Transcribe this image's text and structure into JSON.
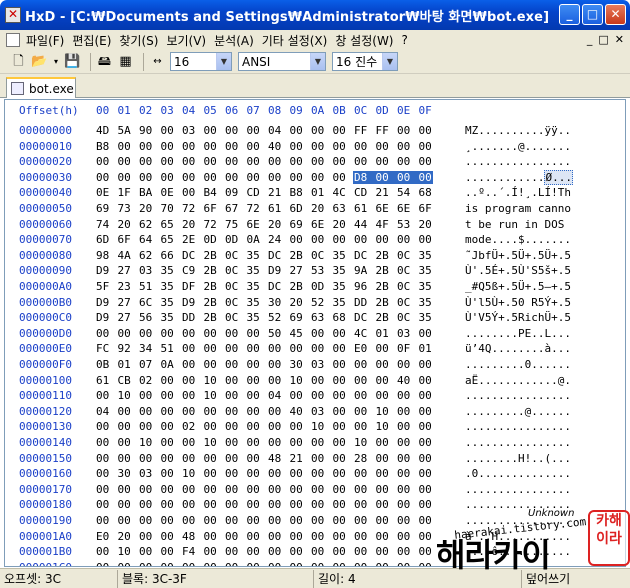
{
  "window": {
    "title": "HxD - [C:₩Documents and Settings₩Administrator₩바탕 화면₩bot.exe]",
    "buttons": [
      "_",
      "□",
      "✕"
    ]
  },
  "menu": {
    "items": [
      "파일(F)",
      "편집(E)",
      "찾기(S)",
      "보기(V)",
      "분석(A)",
      "기타 설정(X)",
      "창 설정(W)",
      "?"
    ],
    "mdi_buttons": [
      "_",
      "□",
      "✕"
    ]
  },
  "toolbar": {
    "bytes_per_row": "16",
    "charset": "ANSI",
    "base": "16 진수"
  },
  "tab": {
    "label": "bot.exe"
  },
  "hex": {
    "header_label": "Offset(h)",
    "columns": [
      "00",
      "01",
      "02",
      "03",
      "04",
      "05",
      "06",
      "07",
      "08",
      "09",
      "0A",
      "0B",
      "0C",
      "0D",
      "0E",
      "0F"
    ],
    "selection": {
      "row": 3,
      "from": 12,
      "to": 15
    },
    "rows": [
      {
        "offset": "00000000",
        "bytes": "4D 5A 90 00 03 00 00 00 04 00 00 00 FF FF 00 00",
        "ascii": "MZ..........ÿÿ.."
      },
      {
        "offset": "00000010",
        "bytes": "B8 00 00 00 00 00 00 00 40 00 00 00 00 00 00 00",
        "ascii": "¸.......@......."
      },
      {
        "offset": "00000020",
        "bytes": "00 00 00 00 00 00 00 00 00 00 00 00 00 00 00 00",
        "ascii": "................"
      },
      {
        "offset": "00000030",
        "bytes": "00 00 00 00 00 00 00 00 00 00 00 00 D8 00 00 00",
        "ascii": "............Ø..."
      },
      {
        "offset": "00000040",
        "bytes": "0E 1F BA 0E 00 B4 09 CD 21 B8 01 4C CD 21 54 68",
        "ascii": "..º..´.Í!¸.LÍ!Th"
      },
      {
        "offset": "00000050",
        "bytes": "69 73 20 70 72 6F 67 72 61 6D 20 63 61 6E 6E 6F",
        "ascii": "is program canno"
      },
      {
        "offset": "00000060",
        "bytes": "74 20 62 65 20 72 75 6E 20 69 6E 20 44 4F 53 20",
        "ascii": "t be run in DOS "
      },
      {
        "offset": "00000070",
        "bytes": "6D 6F 64 65 2E 0D 0D 0A 24 00 00 00 00 00 00 00",
        "ascii": "mode....$......."
      },
      {
        "offset": "00000080",
        "bytes": "98 4A 62 66 DC 2B 0C 35 DC 2B 0C 35 DC 2B 0C 35",
        "ascii": "˜JbfÜ+.5Ü+.5Ü+.5"
      },
      {
        "offset": "00000090",
        "bytes": "D9 27 03 35 C9 2B 0C 35 D9 27 53 35 9A 2B 0C 35",
        "ascii": "Ù'.5É+.5Ù'S5š+.5"
      },
      {
        "offset": "000000A0",
        "bytes": "5F 23 51 35 DF 2B 0C 35 DC 2B 0D 35 96 2B 0C 35",
        "ascii": "_#Q5ß+.5Ü+.5–+.5"
      },
      {
        "offset": "000000B0",
        "bytes": "D9 27 6C 35 D9 2B 0C 35 30 20 52 35 DD 2B 0C 35",
        "ascii": "Ù'l5Ù+.50 R5Ý+.5"
      },
      {
        "offset": "000000C0",
        "bytes": "D9 27 56 35 DD 2B 0C 35 52 69 63 68 DC 2B 0C 35",
        "ascii": "Ù'V5Ý+.5RichÜ+.5"
      },
      {
        "offset": "000000D0",
        "bytes": "00 00 00 00 00 00 00 00 50 45 00 00 4C 01 03 00",
        "ascii": "........PE..L..."
      },
      {
        "offset": "000000E0",
        "bytes": "FC 92 34 51 00 00 00 00 00 00 00 00 E0 00 0F 01",
        "ascii": "ü’4Q........à..."
      },
      {
        "offset": "000000F0",
        "bytes": "0B 01 07 0A 00 00 00 00 00 30 03 00 00 00 00 00",
        "ascii": ".........0......"
      },
      {
        "offset": "00000100",
        "bytes": "61 CB 02 00 00 10 00 00 00 10 00 00 00 00 40 00",
        "ascii": "aË............@."
      },
      {
        "offset": "00000110",
        "bytes": "00 10 00 00 00 10 00 00 04 00 00 00 00 00 00 00",
        "ascii": "................"
      },
      {
        "offset": "00000120",
        "bytes": "04 00 00 00 00 00 00 00 00 40 03 00 00 10 00 00",
        "ascii": ".........@......"
      },
      {
        "offset": "00000130",
        "bytes": "00 00 00 00 02 00 00 00 00 00 10 00 00 10 00 00",
        "ascii": "................"
      },
      {
        "offset": "00000140",
        "bytes": "00 00 10 00 00 10 00 00 00 00 00 00 10 00 00 00",
        "ascii": "................"
      },
      {
        "offset": "00000150",
        "bytes": "00 00 00 00 00 00 00 00 48 21 00 00 28 00 00 00",
        "ascii": "........H!..(..."
      },
      {
        "offset": "00000160",
        "bytes": "00 30 03 00 10 00 00 00 00 00 00 00 00 00 00 00",
        "ascii": ".0.............."
      },
      {
        "offset": "00000170",
        "bytes": "00 00 00 00 00 00 00 00 00 00 00 00 00 00 00 00",
        "ascii": "................"
      },
      {
        "offset": "00000180",
        "bytes": "00 00 00 00 00 00 00 00 00 00 00 00 00 00 00 00",
        "ascii": "................"
      },
      {
        "offset": "00000190",
        "bytes": "00 00 00 00 00 00 00 00 00 00 00 00 00 00 00 00",
        "ascii": "................"
      },
      {
        "offset": "000001A0",
        "bytes": "E0 20 00 00 48 00 00 00 00 00 00 00 00 00 00 00",
        "ascii": "à ..H..........."
      },
      {
        "offset": "000001B0",
        "bytes": "00 10 00 00 F4 00 00 00 00 00 00 00 00 00 00 00",
        "ascii": "....ô..........."
      },
      {
        "offset": "000001C0",
        "bytes": "00 00 00 00 00 00 00 00 00 00 00 00 00 00 00 00",
        "ascii": "................"
      }
    ]
  },
  "status": {
    "offset": "오프셋: 3C",
    "block": "블록: 3C-3F",
    "length": "길이: 4",
    "mode": "덮어쓰기"
  },
  "watermark": {
    "url": "haerakai.tistory.com",
    "tag": "Unknown",
    "name": "해라카이",
    "seal": "카해이라"
  }
}
